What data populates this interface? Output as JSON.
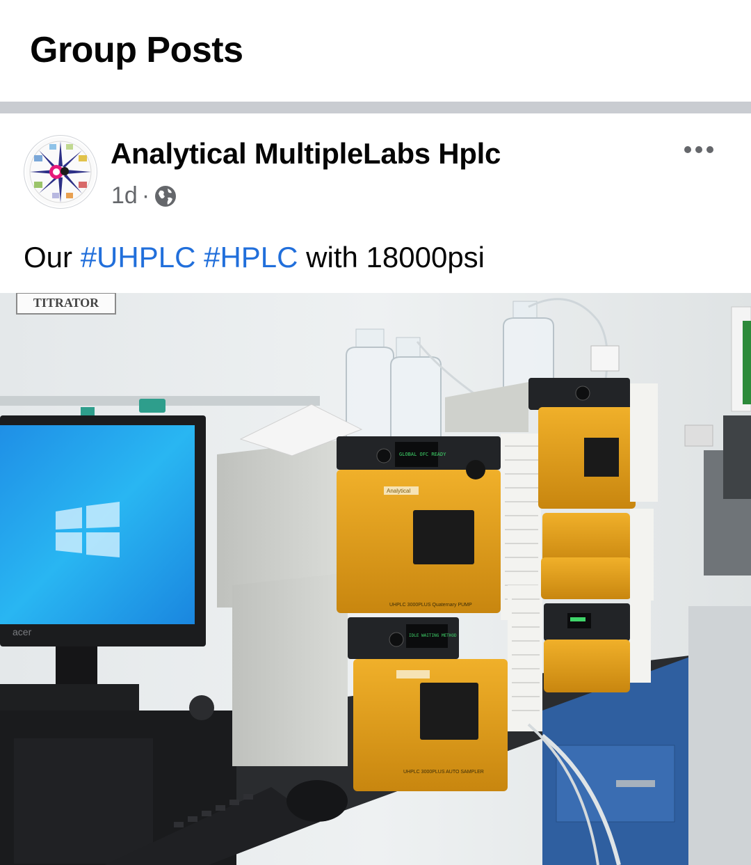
{
  "header": {
    "title": "Group Posts"
  },
  "post": {
    "author": "Analytical MultipleLabs Hplc",
    "time": "1d",
    "separator": "·",
    "privacy_icon": "globe-icon",
    "more_icon": "more-horizontal-icon",
    "text_prefix": "Our ",
    "hashtags": [
      "#UHPLC",
      "#HPLC"
    ],
    "text_suffix": " with 18000psi",
    "photo": {
      "wall_sign": "TITRATOR",
      "monitor_brand": "acer",
      "pump_display": "GLOBAL  OFC  READY",
      "sampler_display": "IDLE  WAITING METHOD",
      "pump_label": "UHPLC 3000PLUS Quaternary PUMP",
      "sampler_label": "UHPLC 3000PLUS AUTO SAMPLER",
      "brand": "Analytical"
    }
  },
  "colors": {
    "hashtag": "#216fdb",
    "meta": "#65676b",
    "separator": "#c9ccd1",
    "instrument_orange": "#e1a21c"
  }
}
